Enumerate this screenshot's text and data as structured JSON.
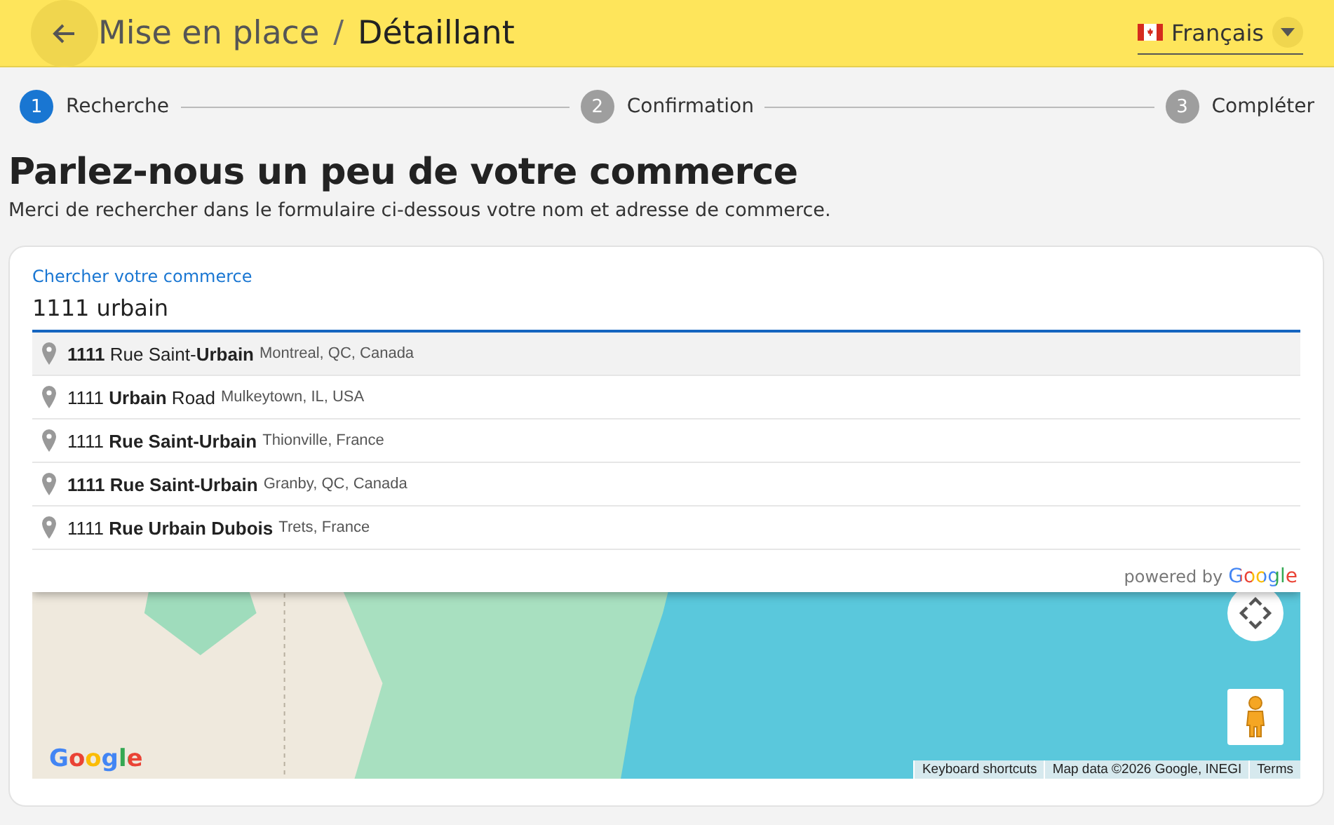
{
  "header": {
    "title": "Mise en place",
    "separator": "/",
    "subtitle": "Détaillant",
    "language": "Français"
  },
  "steps": [
    {
      "number": "1",
      "label": "Recherche",
      "selected": true
    },
    {
      "number": "2",
      "label": "Confirmation",
      "selected": false
    },
    {
      "number": "3",
      "label": "Compléter",
      "selected": false
    }
  ],
  "heading": "Parlez-nous un peu de votre commerce",
  "intro": "Merci de rechercher dans le formulaire ci-dessous votre nom et adresse de commerce.",
  "search": {
    "label": "Chercher votre commerce",
    "value": "1111 urbain"
  },
  "suggestions": [
    {
      "main": "**1111** Rue Saint-**Urbain**",
      "secondary": "Montreal, QC, Canada",
      "selected": true
    },
    {
      "main": "1111 **Urbain** Road",
      "secondary": "Mulkeytown, IL, USA",
      "selected": false
    },
    {
      "main": "1111 **Rue Saint-Urbain**",
      "secondary": "Thionville, France",
      "selected": false
    },
    {
      "main": "**1111 Rue Saint-Urbain**",
      "secondary": "Granby, QC, Canada",
      "selected": false
    },
    {
      "main": "1111 **Rue Urbain Dubois**",
      "secondary": "Trets, France",
      "selected": false
    }
  ],
  "powered_by": {
    "text": "powered by",
    "brand": "Google"
  },
  "map": {
    "logo": "Google",
    "attribution": [
      "Keyboard shortcuts",
      "Map data ©2026 Google, INEGI",
      "Terms"
    ]
  }
}
